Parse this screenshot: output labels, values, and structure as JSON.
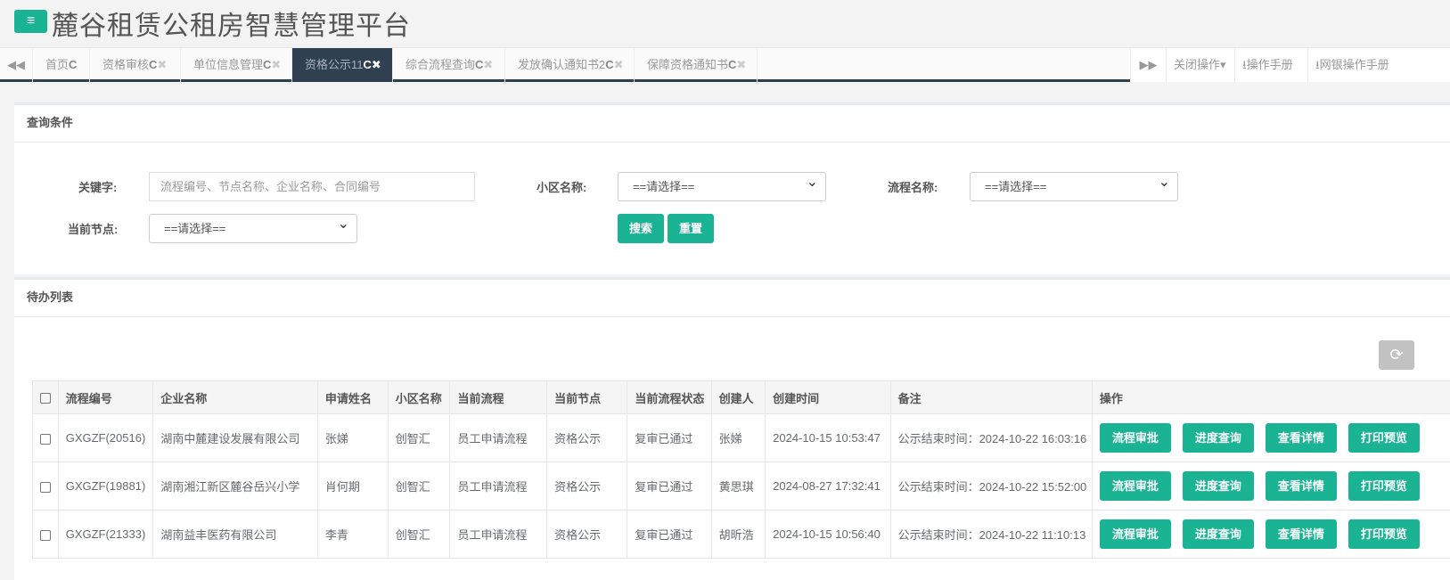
{
  "header": {
    "menu_icon": "≡",
    "title": "麓谷租赁公租房智慧管理平台"
  },
  "tabs": [
    {
      "label": "首页",
      "closable": false
    },
    {
      "label": "资格审核",
      "closable": true
    },
    {
      "label": "单位信息管理",
      "closable": true
    },
    {
      "label": "资格公示11",
      "closable": true,
      "active": true
    },
    {
      "label": "综合流程查询",
      "closable": true
    },
    {
      "label": "发放确认通知书2",
      "closable": true
    },
    {
      "label": "保障资格通知书",
      "closable": true
    }
  ],
  "tabbar_right": {
    "close_ops": "关闭操作",
    "manual": "操作手册",
    "bank_manual": "网银操作手册"
  },
  "query": {
    "title": "查询条件",
    "keyword_label": "关键字:",
    "keyword_placeholder": "流程编号、节点名称、企业名称、合同编号",
    "community_label": "小区名称:",
    "community_value": "==请选择==",
    "flow_label": "流程名称:",
    "flow_value": "==请选择==",
    "node_label": "当前节点:",
    "node_value": "==请选择==",
    "search": "搜索",
    "reset": "重置"
  },
  "list": {
    "title": "待办列表",
    "columns": [
      "流程编号",
      "企业名称",
      "申请姓名",
      "小区名称",
      "当前流程",
      "当前节点",
      "当前流程状态",
      "创建人",
      "创建时间",
      "备注",
      "操作"
    ],
    "rows": [
      [
        "GXGZF(20516)",
        "湖南中麓建设发展有限公司",
        "张娣",
        "创智汇",
        "员工申请流程",
        "资格公示",
        "复审已通过",
        "张娣",
        "2024-10-15 10:53:47",
        "公示结束时间：2024-10-22 16:03:16"
      ],
      [
        "GXGZF(19881)",
        "湖南湘江新区麓谷岳兴小学",
        "肖何期",
        "创智汇",
        "员工申请流程",
        "资格公示",
        "复审已通过",
        "黄思琪",
        "2024-08-27 17:32:41",
        "公示结束时间：2024-10-22 15:52:00"
      ],
      [
        "GXGZF(21333)",
        "湖南益丰医药有限公司",
        "李青",
        "创智汇",
        "员工申请流程",
        "资格公示",
        "复审已通过",
        "胡昕浩",
        "2024-10-15 10:56:40",
        "公示结束时间：2024-10-22 11:10:13"
      ]
    ],
    "actions": [
      "流程审批",
      "进度查询",
      "查看详情",
      "打印预览"
    ]
  }
}
